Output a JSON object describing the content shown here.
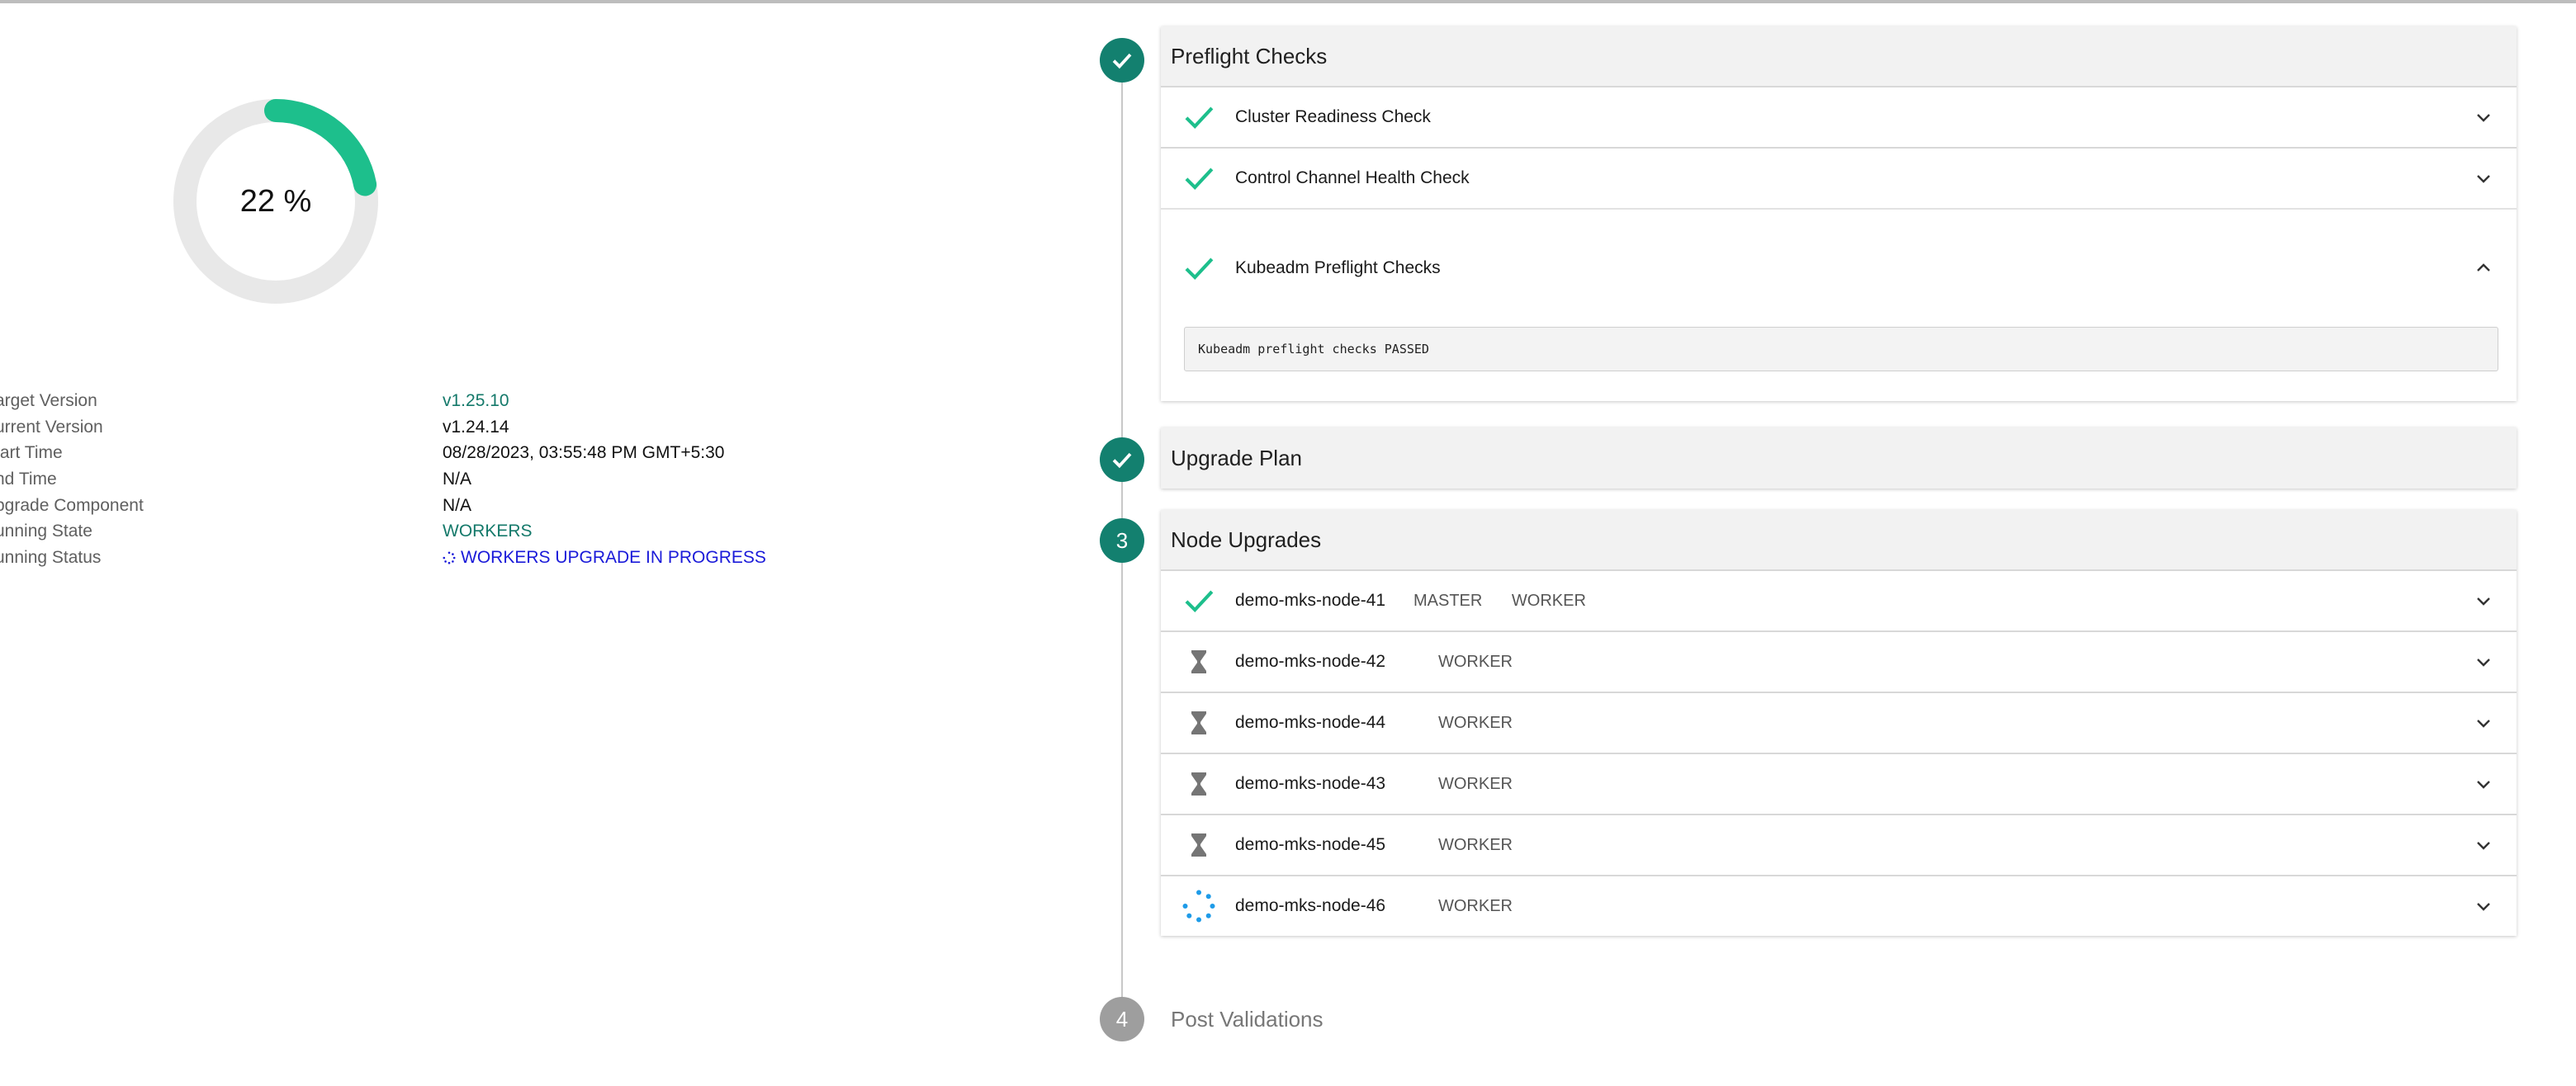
{
  "progress": {
    "label": "22 %",
    "fraction": 0.22,
    "color": "#1dbf8c",
    "track_color": "#e8e8e8"
  },
  "info": [
    {
      "key": "arget Version",
      "value": "v1.25.10",
      "style": "green"
    },
    {
      "key": "urrent Version",
      "value": "v1.24.14",
      "style": "normal"
    },
    {
      "key": "tart Time",
      "value": "08/28/2023, 03:55:48 PM GMT+5:30",
      "style": "normal"
    },
    {
      "key": "nd Time",
      "value": "N/A",
      "style": "normal"
    },
    {
      "key": "pgrade Component",
      "value": "N/A",
      "style": "normal"
    },
    {
      "key": "unning State",
      "value": "WORKERS",
      "style": "green"
    },
    {
      "key": "unning Status",
      "value": "WORKERS UPGRADE IN PROGRESS",
      "style": "blue"
    }
  ],
  "steps": {
    "preflight": {
      "title": "Preflight Checks",
      "status": "done",
      "items": [
        {
          "name": "Cluster Readiness Check",
          "status": "passed"
        },
        {
          "name": "Control Channel Health Check",
          "status": "passed"
        },
        {
          "name": "Kubeadm Preflight Checks",
          "status": "passed",
          "expanded": true,
          "log": "Kubeadm preflight checks PASSED"
        }
      ]
    },
    "plan": {
      "title": "Upgrade Plan",
      "status": "done"
    },
    "nodes": {
      "number": "3",
      "title": "Node Upgrades",
      "status": "active",
      "items": [
        {
          "name": "demo-mks-node-41",
          "roles": [
            "MASTER",
            "WORKER"
          ],
          "status": "done"
        },
        {
          "name": "demo-mks-node-42",
          "roles": [
            "WORKER"
          ],
          "status": "pending"
        },
        {
          "name": "demo-mks-node-44",
          "roles": [
            "WORKER"
          ],
          "status": "pending"
        },
        {
          "name": "demo-mks-node-43",
          "roles": [
            "WORKER"
          ],
          "status": "pending"
        },
        {
          "name": "demo-mks-node-45",
          "roles": [
            "WORKER"
          ],
          "status": "pending"
        },
        {
          "name": "demo-mks-node-46",
          "roles": [
            "WORKER"
          ],
          "status": "in-progress"
        }
      ]
    },
    "post": {
      "number": "4",
      "title": "Post Validations",
      "status": "pending"
    }
  },
  "colors": {
    "check": "#1dbf8c",
    "step_active": "#13806f",
    "step_pending": "#9e9e9e",
    "hourglass": "#757575",
    "spinner": "#1e9be8"
  }
}
